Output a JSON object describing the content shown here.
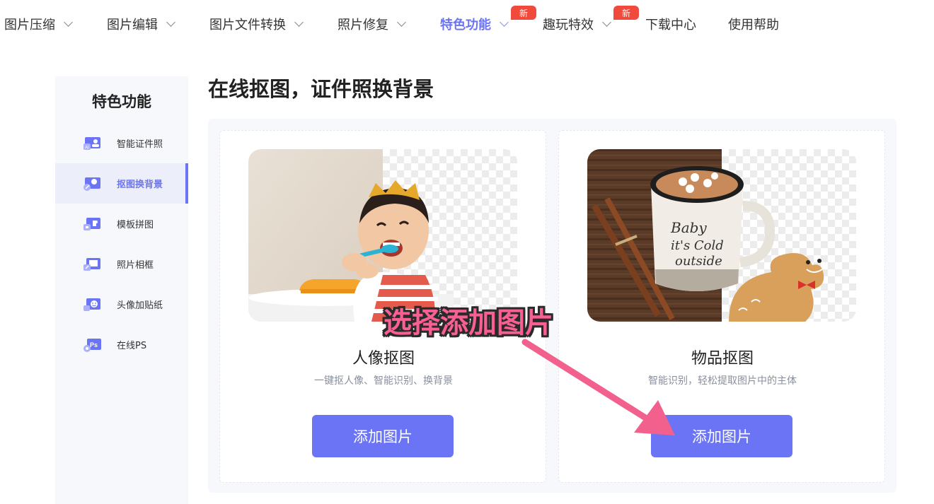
{
  "nav": {
    "items": [
      {
        "label": "图片压缩"
      },
      {
        "label": "图片编辑"
      },
      {
        "label": "图片文件转换"
      },
      {
        "label": "照片修复"
      },
      {
        "label": "特色功能"
      },
      {
        "label": "趣玩特效"
      },
      {
        "label": "下载中心"
      },
      {
        "label": "使用帮助"
      }
    ],
    "badge_text": "新"
  },
  "sidebar": {
    "title": "特色功能",
    "items": [
      {
        "label": "智能证件照",
        "icon": "id-photo-icon"
      },
      {
        "label": "抠图换背景",
        "icon": "cutout-icon"
      },
      {
        "label": "模板拼图",
        "icon": "puzzle-icon"
      },
      {
        "label": "照片相框",
        "icon": "frame-icon"
      },
      {
        "label": "头像加贴纸",
        "icon": "sticker-icon"
      },
      {
        "label": "在线PS",
        "icon": "ps-icon"
      }
    ]
  },
  "main": {
    "title": "在线抠图，证件照换背景",
    "cards": [
      {
        "title": "人像抠图",
        "desc": "一键抠人像、智能识别、换背景",
        "button": "添加图片"
      },
      {
        "title": "物品抠图",
        "desc": "智能识别，轻松提取图片中的主体",
        "button": "添加图片"
      }
    ]
  },
  "annotation": {
    "text": "选择添加图片"
  },
  "colors": {
    "accent": "#6b74f5",
    "badge": "#f04a3c",
    "annotation": "#f85f93"
  }
}
